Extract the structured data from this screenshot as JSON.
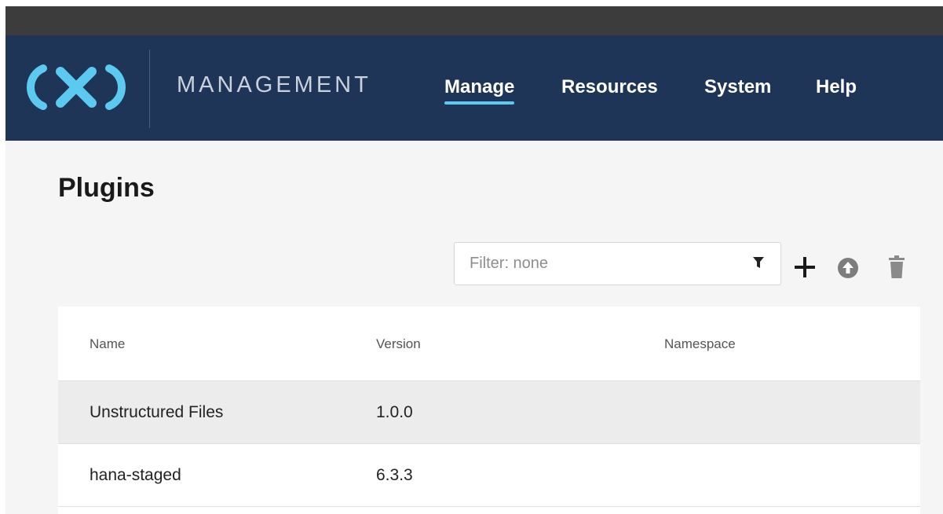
{
  "app": {
    "brand_name": "MANAGEMENT",
    "nav": [
      {
        "label": "Manage",
        "active": true
      },
      {
        "label": "Resources",
        "active": false
      },
      {
        "label": "System",
        "active": false
      },
      {
        "label": "Help",
        "active": false
      }
    ]
  },
  "page": {
    "title": "Plugins"
  },
  "filter": {
    "placeholder": "Filter: none",
    "value": ""
  },
  "toolbar": {
    "add_icon": "plus-icon",
    "upload_icon": "upload-icon",
    "delete_icon": "trash-icon"
  },
  "table": {
    "columns": [
      "Name",
      "Version",
      "Namespace"
    ],
    "rows": [
      {
        "name": "Unstructured Files",
        "version": "1.0.0",
        "namespace": ""
      },
      {
        "name": "hana-staged",
        "version": "6.3.3",
        "namespace": ""
      }
    ]
  },
  "colors": {
    "nav_bg": "#1f3558",
    "accent": "#5cc9f0",
    "selected_row_bg": "#ececec"
  }
}
